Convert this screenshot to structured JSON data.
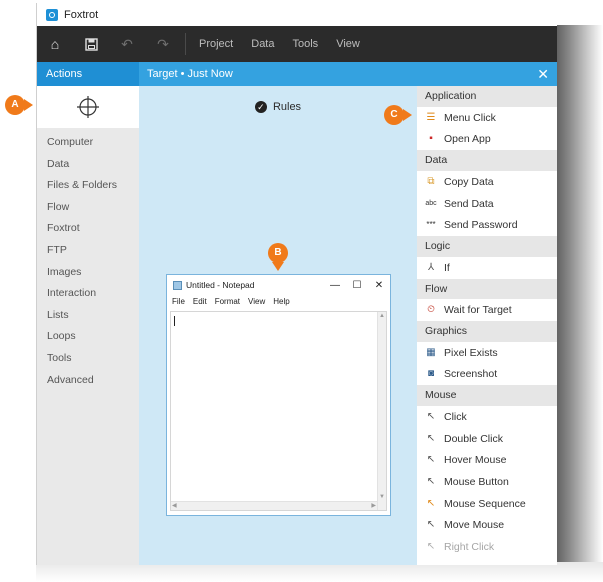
{
  "window": {
    "title": "Foxtrot"
  },
  "toolbar": {
    "menus": [
      "Project",
      "Data",
      "Tools",
      "View"
    ]
  },
  "panels": {
    "actions_title": "Actions",
    "target_title": "Target • Just Now"
  },
  "rules": {
    "label": "Rules"
  },
  "categories": [
    "Computer",
    "Data",
    "Files & Folders",
    "Flow",
    "Foxtrot",
    "FTP",
    "Images",
    "Interaction",
    "Lists",
    "Loops",
    "Tools",
    "Advanced"
  ],
  "notepad": {
    "title": "Untitled - Notepad",
    "menus": [
      "File",
      "Edit",
      "Format",
      "View",
      "Help"
    ]
  },
  "action_sections": [
    {
      "title": "Application",
      "items": [
        {
          "label": "Menu Click",
          "icon": "menu-click-icon"
        },
        {
          "label": "Open App",
          "icon": "open-app-icon"
        }
      ]
    },
    {
      "title": "Data",
      "items": [
        {
          "label": "Copy Data",
          "icon": "copy-data-icon"
        },
        {
          "label": "Send Data",
          "icon": "send-data-icon"
        },
        {
          "label": "Send Password",
          "icon": "send-password-icon"
        }
      ]
    },
    {
      "title": "Logic",
      "items": [
        {
          "label": "If",
          "icon": "if-icon"
        }
      ]
    },
    {
      "title": "Flow",
      "items": [
        {
          "label": "Wait for Target",
          "icon": "wait-for-target-icon"
        }
      ]
    },
    {
      "title": "Graphics",
      "items": [
        {
          "label": "Pixel Exists",
          "icon": "pixel-exists-icon"
        },
        {
          "label": "Screenshot",
          "icon": "screenshot-icon"
        }
      ]
    },
    {
      "title": "Mouse",
      "items": [
        {
          "label": "Click",
          "icon": "click-icon"
        },
        {
          "label": "Double Click",
          "icon": "double-click-icon"
        },
        {
          "label": "Hover Mouse",
          "icon": "hover-mouse-icon"
        },
        {
          "label": "Mouse Button",
          "icon": "mouse-button-icon"
        },
        {
          "label": "Mouse Sequence",
          "icon": "mouse-sequence-icon"
        },
        {
          "label": "Move Mouse",
          "icon": "move-mouse-icon"
        },
        {
          "label": "Right Click",
          "icon": "right-click-icon"
        }
      ]
    }
  ],
  "callouts": {
    "a": "A",
    "b": "B",
    "c": "C"
  },
  "colors": {
    "callout": "#f07a1a",
    "actions_header": "#1f8fd4",
    "target_header": "#34a2e0",
    "canvas": "#cfe8f6",
    "toolbar": "#2b2b2b"
  }
}
